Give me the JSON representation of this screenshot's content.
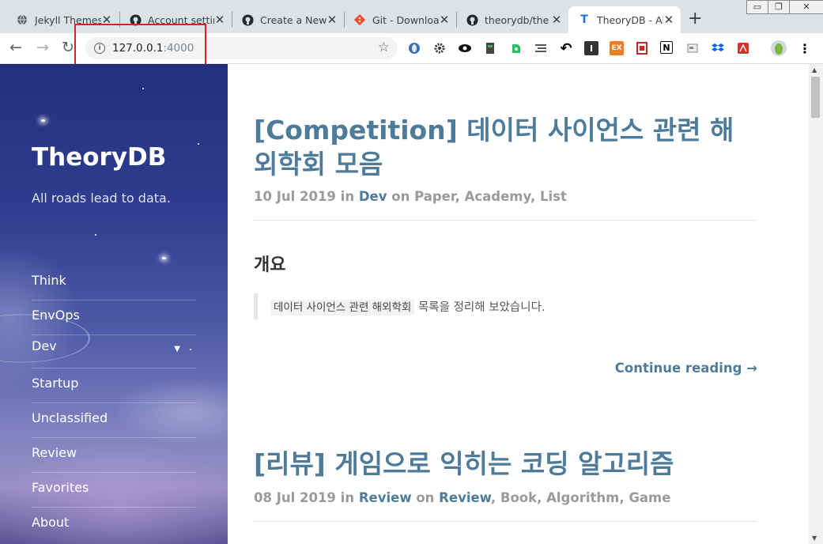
{
  "browser": {
    "tabs": [
      {
        "label": "Jekyll Themes",
        "icon": "globe-icon"
      },
      {
        "label": "Account settin",
        "icon": "github-icon"
      },
      {
        "label": "Create a New",
        "icon": "github-icon"
      },
      {
        "label": "Git - Downloa",
        "icon": "git-icon"
      },
      {
        "label": "theorydb/the",
        "icon": "github-icon"
      },
      {
        "label": "TheoryDB - Al",
        "icon": "theorydb-icon",
        "active": true
      }
    ],
    "new_tab_label": "+",
    "url_host": "127.0.0.1",
    "url_port": ":4000",
    "window_controls": [
      "minimize",
      "restore",
      "close"
    ],
    "extensions": [
      "opera-icon",
      "gear-icon",
      "eye-icon",
      "clip-icon",
      "evernote-icon",
      "list-icon",
      "reply-icon",
      "i-icon",
      "ex-icon",
      "pdf-icon",
      "notion-icon",
      "card-icon",
      "dropbox-icon",
      "acrobat-icon"
    ],
    "extension_labels": {
      "i": "I",
      "ex": "EX",
      "notion": "N"
    }
  },
  "colors": {
    "link": "#4e7b9a",
    "meta": "#9a9a9a",
    "highlight": "#e02020"
  },
  "sidebar": {
    "title": "TheoryDB",
    "tagline": "All roads lead to data.",
    "nav": [
      {
        "label": "Think"
      },
      {
        "label": "EnvOps"
      },
      {
        "label": "Dev",
        "has_dropdown": true
      },
      {
        "label": "Startup"
      },
      {
        "label": "Unclassified"
      },
      {
        "label": "Review"
      },
      {
        "label": "Favorites"
      },
      {
        "label": "About"
      }
    ]
  },
  "posts": [
    {
      "title": "[Competition] 데이터 사이언스 관련 해외학회 모음",
      "date": "10 Jul 2019",
      "in_word": "in",
      "category": "Dev",
      "on_word": "on",
      "tags": [
        "Paper",
        "Academy",
        "List"
      ],
      "heading": "개요",
      "quote_code": "데이터 사이언스 관련 해외학회",
      "quote_text": "목록을 정리해 보았습니다.",
      "continue": "Continue reading →"
    },
    {
      "title": "[리뷰] 게임으로 익히는 코딩 알고리즘",
      "date": "08 Jul 2019",
      "in_word": "in",
      "category": "Review",
      "on_word": "on",
      "tags": [
        "Review",
        "Book",
        "Algorithm",
        "Game"
      ]
    }
  ]
}
